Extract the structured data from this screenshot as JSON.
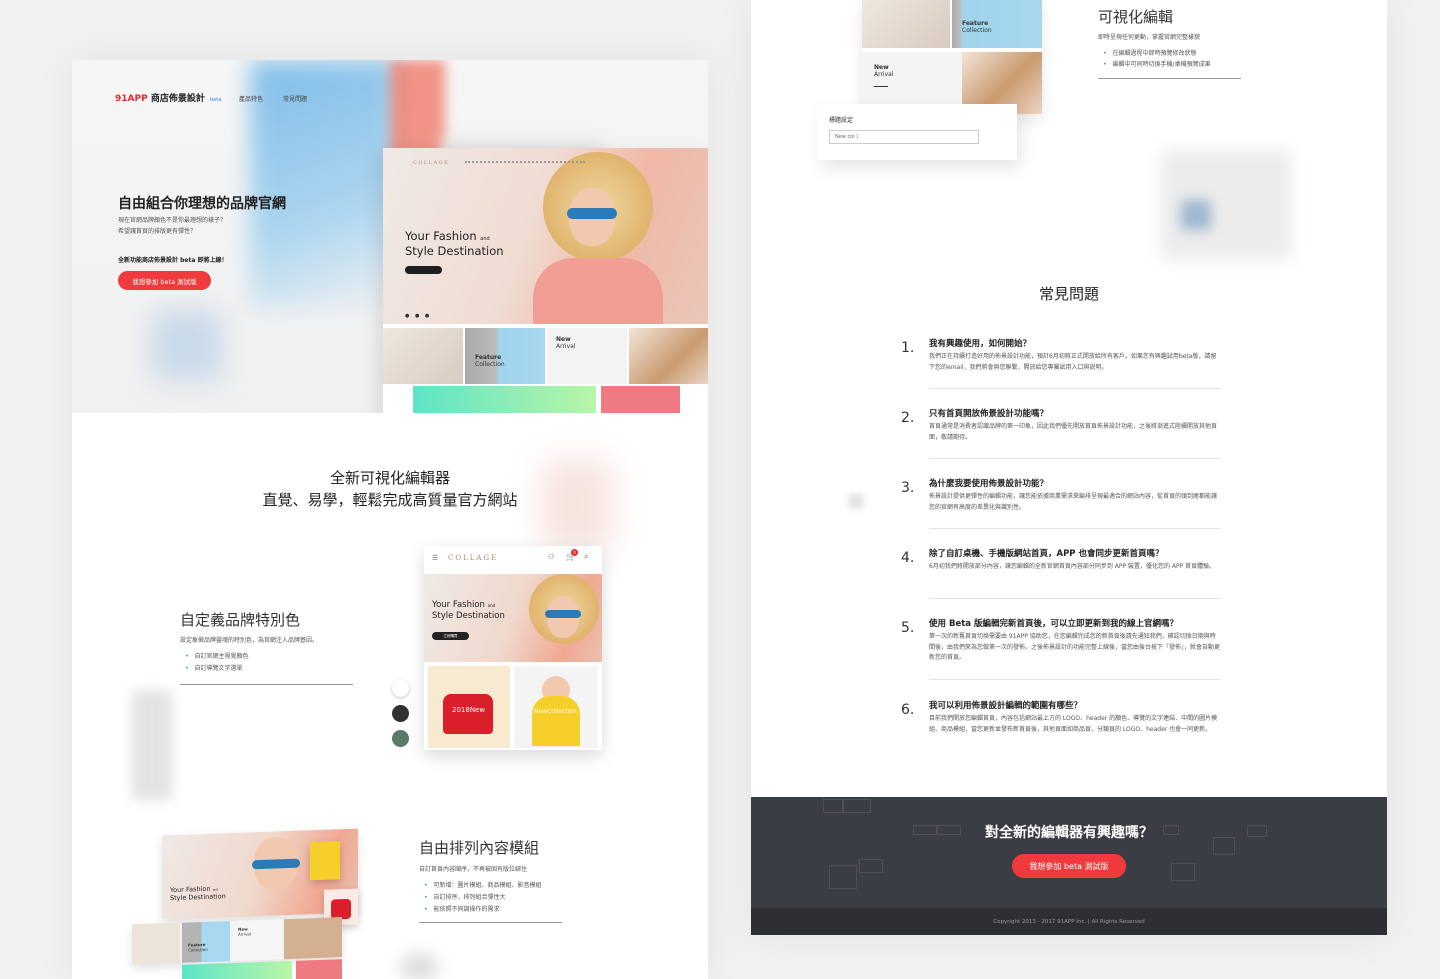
{
  "left_page": {
    "header": {
      "logo_brand": "91APP",
      "logo_text": "商店佈景設計",
      "logo_badge": "beta",
      "nav": [
        "產品特色",
        "常見問題"
      ]
    },
    "hero": {
      "title": "自由組合你理想的品牌官網",
      "desc_line1": "現在官網品牌顏色不是你最理想的樣子？",
      "desc_line2": "希望讓首頁的排版更有彈性？",
      "note": "全新功能商店佈景設計 beta 即將上線！",
      "cta_label": "我想參加 beta 測試版"
    },
    "mockup": {
      "store_name": "COLLAGE",
      "banner_title_1": "Your Fashion",
      "banner_title_and": "and",
      "banner_title_2": "Style Destination",
      "button_label": "了解更多",
      "dots": "● ● ●",
      "tile_feature": "Feature",
      "tile_collection": "Collection",
      "tile_new": "New",
      "tile_arrival": "Arrival"
    },
    "section2": {
      "title_line1": "全新可視化編輯器",
      "title_line2": "直覺、易學，輕鬆完成高質量官方網站"
    },
    "feature1": {
      "title": "自定義品牌特別色",
      "desc": "設定象徵品牌靈魂的特別色，為官網注入品牌基因。",
      "bullets": [
        "自訂官網主視覺顏色",
        "自訂導覽文字選單"
      ]
    },
    "phone_mock": {
      "store_name": "COLLAGE",
      "banner_title_1": "Your Fashion",
      "banner_title_and": "and",
      "banner_title_2": "Style Destination",
      "button_label": "立即購買",
      "cart_count": "0",
      "tile1_label": "2018New",
      "tile2_label": "NewCollection"
    },
    "swatches": {
      "colors": [
        "#ffffff",
        "#2f3133",
        "#5a7a6c"
      ]
    },
    "feature2": {
      "title": "自由排列內容模組",
      "desc": "自訂首頁內容順序，不再被固有版位綁住",
      "bullets": [
        "可新增：圖片模組、商品模組、影音模組",
        "自訂排序，排列組合彈性大",
        "能依照不同調操作的需求"
      ]
    },
    "mini_mock": {
      "banner_title_1": "Your Fashion",
      "banner_title_and": "and",
      "banner_title_2": "Style Destination",
      "tile_feature": "Feature",
      "tile_collection": "Collection",
      "tile_new": "New",
      "tile_arrival": "Arrival"
    }
  },
  "right_page": {
    "top_tiles": {
      "feature": "Feature",
      "collection": "Collection",
      "new": "New",
      "arrival": "Arrival"
    },
    "editor_panel": {
      "field_label": "標題設定",
      "field_value": "New col |"
    },
    "visual_editing": {
      "title": "可視化編輯",
      "desc": "即時呈現任何更動，掌握官網完整樣貌",
      "bullets": [
        "在編輯過程中即時預覽修改狀態",
        "編輯中可同時切換手機/桌機預覽成果"
      ]
    },
    "faq": {
      "heading": "常見問題",
      "items": [
        {
          "num": "1.",
          "q": "我有興趣使用，如何開始？",
          "a": "我們正在持續打造好用的佈景設計功能，預計6月初將正式開放給所有客戶。如果您有興趣試用beta版，請留下您的email，我們將會與您聯繫，開放給您專屬試用入口與說明。"
        },
        {
          "num": "2.",
          "q": "只有首頁開放佈景設計功能嗎？",
          "a": "首頁通常是消費者認識品牌的第一印象，因此我們優先開放首頁佈景設計功能，之後將漸進式陸續開放其他頁面，敬請期待。"
        },
        {
          "num": "3.",
          "q": "為什麼我要使用佈景設計功能？",
          "a": "佈景設計提供更彈性的編輯功能，讓您能依據商業需求來編排呈現最適合的網站內容，從首頁的頭到尾都能讓您的官網有高度的差異化與識別性。"
        },
        {
          "num": "4.",
          "q": "除了自訂桌機、手機版網站首頁，APP 也會同步更新首頁嗎？",
          "a": "6月初我們將開放部分內容，讓您編輯的全新官網首頁內容部分同步到 APP 裝置，優化您的 APP 首頁體驗。"
        },
        {
          "num": "5.",
          "q": "使用 Beta 版編輯完新首頁後，可以立即更新到我的線上官網嗎？",
          "a": "第一次的新舊首頁切換需要由 91APP 協助您，在您編輯完成您的新首頁後請先通知我們，確認切換日期與時間後，由我們來為您做第一次的發佈。之後佈景設計的功能完整上線後，當您由後台按下「發佈」，就會自動更新您的首頁。"
        },
        {
          "num": "6.",
          "q": "我可以利用佈景設計編輯的範圍有哪些？",
          "a": "目前我們開放您編輯首頁，內容包括網站最上方的 LOGO、header 的顏色、導覽的文字連結、中間的圖片模組、商品模組，當您更新並發布新首頁後，其他頁面如商品頁、分類頁的 LOGO、header 也會一同更新。"
        }
      ]
    },
    "cta": {
      "title": "對全新的編輯器有興趣嗎？",
      "button_label": "我想參加 beta 測試版"
    },
    "footer": {
      "copyright": "Copyright 2013 - 2017 91APP Inc. | All Rights Reserved"
    }
  }
}
